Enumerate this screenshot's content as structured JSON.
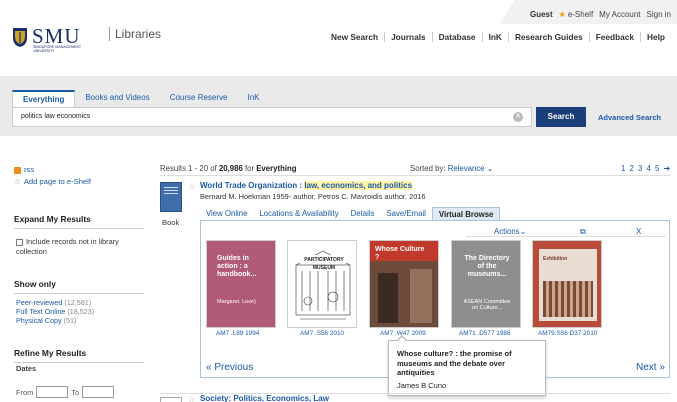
{
  "util_bar": {
    "guest": "Guest",
    "eshelf": "e-Shelf",
    "my_account": "My Account",
    "sign_in": "Sign in"
  },
  "logo": {
    "name": "SMU",
    "sub_line1": "SINGAPORE MANAGEMENT",
    "sub_line2": "UNIVERSITY"
  },
  "site_title": "Libraries",
  "main_nav": [
    "New Search",
    "Journals",
    "Database",
    "InK",
    "Research Guides",
    "Feedback",
    "Help"
  ],
  "search": {
    "tabs": [
      "Everything",
      "Books and Videos",
      "Course Reserve",
      "InK"
    ],
    "active_tab": "Everything",
    "query": "politics law economics",
    "button": "Search",
    "advanced": "Advanced Search"
  },
  "sidebar": {
    "rss": "rss",
    "add_eshelf": "Add page to e-Shelf",
    "expand_heading": "Expand My Results",
    "expand_option": "Include records not in library collection",
    "show_only_heading": "Show only",
    "show_only": [
      {
        "label": "Peer-reviewed",
        "count": "(12,581)"
      },
      {
        "label": "Full Text Online",
        "count": "(18,523)"
      },
      {
        "label": "Physical Copy",
        "count": "(51)"
      }
    ],
    "refine_heading": "Refine My Results",
    "dates_label": "Dates",
    "from_label": "From",
    "to_label": "To"
  },
  "results": {
    "summary_prefix": "Results 1 - 20 of ",
    "total": "20,986",
    "summary_suffix": " for ",
    "scope": "Everything",
    "sort_label": "Sorted by:",
    "sort_value": "Relevance",
    "pages": "1 2 3 4 5 ➔",
    "item": {
      "type": "Book",
      "title_start": "World Trade Organization : ",
      "title_highlight": "law, economics, and politics",
      "author": "Bernard M. Hoekman 1959- author. Petros C. Mavroidis author. 2016",
      "tabs": [
        "View Online",
        "Locations & Availability",
        "Details",
        "Save/Email",
        "Virtual Browse"
      ],
      "active_tab": "Virtual Browse"
    },
    "next_item_title": "Society: Politics, Economics, Law"
  },
  "virtual_browse": {
    "actions": "Actions",
    "external": "⧉",
    "close": "X",
    "prev": "« Previous",
    "next": "Next »",
    "covers": [
      {
        "title": "Guides in action : a handbook...",
        "subtitle": "Margaret. Love)",
        "call": "AM7 .L89 1994",
        "color": "#b15a78"
      },
      {
        "title": "Participatory Museum",
        "subtitle": "",
        "call": "AM7 .S56 2010",
        "color": "#ffffff"
      },
      {
        "title": "Whose Culture ?",
        "subtitle": "",
        "call": "AM7 .W47 2009",
        "color": "#6d4b3a"
      },
      {
        "title": "The Directory of the museums...",
        "subtitle": "ASEAN Committee on Culture...",
        "call": "AM71 .D577 1988",
        "color": "#8e8e8e"
      },
      {
        "title": "Exhibition",
        "subtitle": "",
        "call": "AM79.S56 D37 2010",
        "color": "#b94b3a"
      }
    ],
    "tooltip": {
      "title": "Whose culture? : the promise of museums and the debate over antiquities",
      "author": "James B Cuno"
    }
  }
}
